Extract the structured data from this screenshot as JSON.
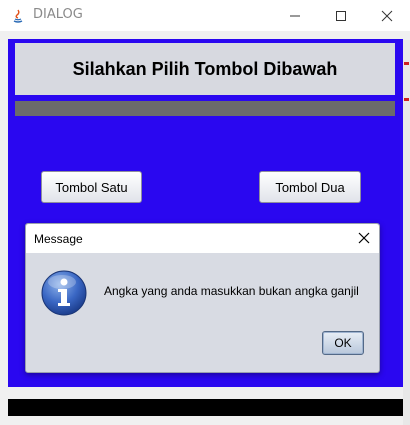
{
  "window": {
    "title": "DIALOG",
    "icons": [
      "java-icon",
      "minimize-icon",
      "maximize-icon",
      "close-icon"
    ]
  },
  "main": {
    "header_title": "Silahkan Pilih Tombol Dibawah",
    "button_one_label": "Tombol Satu",
    "button_two_label": "Tombol Dua",
    "colors": {
      "panel_background": "#2a07f0",
      "header_background": "#d7d9e0",
      "bar": "#6b6b6b",
      "bottom_bar": "#000000"
    }
  },
  "dialog": {
    "title": "Message",
    "icon": "info-icon",
    "message": "Angka yang anda masukkan bukan angka ganjil",
    "ok_label": "OK"
  }
}
